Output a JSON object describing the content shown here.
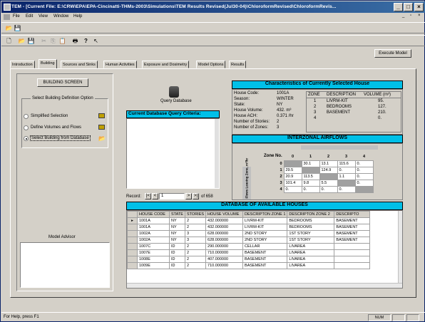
{
  "window": {
    "title": "TEM - [Current File:  E:\\CRW\\EPA\\EPA-Cincinatti-THMs-2003\\Simulations\\TEM Results Revised(Jul30-04)\\ChloroformRevised\\ChloroformRevis..."
  },
  "menu": [
    "File",
    "Edit",
    "View",
    "Window",
    "Help"
  ],
  "execute_label": "Execute Model",
  "tabs": [
    "Introduction",
    "Building",
    "Sources and Sinks",
    "Human Activities",
    "Exposure and Dosimetry",
    "Model Options",
    "Results"
  ],
  "left": {
    "building_screen_label": "BUILDING SCREEN",
    "option_group_title": "Select Building Definition Option",
    "options": [
      "Simplified Selection",
      "Define Volumes and Flows",
      "Select Building from Database"
    ],
    "selected_option": 2,
    "advisor_title": "Model Advisor"
  },
  "query": {
    "icon_label": "Query Database",
    "criteria_title": "Current Database Query Criteria:",
    "record_label": "Record:",
    "record_value": "1",
    "record_of": "of  658"
  },
  "house": {
    "title": "Characteristics of Currently Selected House",
    "fields": [
      {
        "label": "House Code:",
        "value": "1001A"
      },
      {
        "label": "Season:",
        "value": "WINTER"
      },
      {
        "label": "State:",
        "value": "NY"
      },
      {
        "label": "House Volume:",
        "value": "432. m³"
      },
      {
        "label": "House ACH:",
        "value": "0.371 /hr"
      },
      {
        "label": "Number of Stories:",
        "value": "2"
      },
      {
        "label": "Number of Zones:",
        "value": "3"
      }
    ],
    "zone_headers": [
      "ZONE",
      "DESCRIPTION",
      "VOLUME (m³)"
    ],
    "zones": [
      [
        "1",
        "LIVRM-KIT",
        "95."
      ],
      [
        "2",
        "BEDROOMS",
        "127."
      ],
      [
        "3",
        "BASEMENT",
        "210."
      ],
      [
        "4",
        "",
        "0."
      ]
    ]
  },
  "airflows": {
    "title": "INTERZONAL AIRFLOWS",
    "zone_no_label": "Zone No.",
    "side_label": "Flows Leaving Zone, m³/hr",
    "cols": [
      "0",
      "1",
      "2",
      "3",
      "4"
    ],
    "rows": [
      {
        "zone": "0",
        "cells": [
          "#",
          "30.1",
          "13.1",
          "115.6",
          "0."
        ]
      },
      {
        "zone": "1",
        "cells": [
          "29.5",
          "#",
          "124.9",
          "0.",
          "0."
        ]
      },
      {
        "zone": "2",
        "cells": [
          "20.9",
          "113.5",
          "#",
          "1.1",
          "0."
        ]
      },
      {
        "zone": "3",
        "cells": [
          "101.4",
          "9.8",
          "5.5",
          "#",
          "0."
        ]
      },
      {
        "zone": "4",
        "cells": [
          "0.",
          "0.",
          "0.",
          "0.",
          "#"
        ]
      }
    ]
  },
  "database": {
    "title": "DATABASE OF AVAILABLE HOUSES",
    "headers": [
      "HOUSE CODE",
      "STATE",
      "STORIES",
      "HOUSE VOLUME",
      "DESCRIPTON ZONE 1",
      "DESCRIPTON ZONE 2",
      "DESCRIPTO"
    ],
    "rows": [
      [
        "1001A",
        "NY",
        "2",
        "432.000000",
        "LIVRM-KIT",
        "BEDROOMS",
        "BASEMENT"
      ],
      [
        "1001A",
        "NY",
        "2",
        "432.000000",
        "LIVRM-KIT",
        "BEDROOMS",
        "BASEMENT"
      ],
      [
        "1002A",
        "NY",
        "3",
        "628.000000",
        "2ND STORY",
        "1ST STORY",
        "BASEMENT"
      ],
      [
        "1002A",
        "NY",
        "3",
        "628.000000",
        "2ND STORY",
        "1ST STORY",
        "BASEMENT"
      ],
      [
        "1007C",
        "ID",
        "2",
        "290.000000",
        "CELLAR",
        "LIVAREA",
        ""
      ],
      [
        "1007E",
        "ID",
        "2",
        "710.000000",
        "BASEMENT",
        "LIVAREA",
        ""
      ],
      [
        "1008E",
        "ID",
        "2",
        "407.000000",
        "BASEMENT",
        "LIVAREA",
        ""
      ],
      [
        "1009E",
        "ID",
        "2",
        "710.000000",
        "BASEMENT",
        "LIVAREA",
        ""
      ]
    ],
    "current_row": 0
  },
  "status": {
    "help_text": "For Help, press F1",
    "num_indicator": "NUM"
  }
}
